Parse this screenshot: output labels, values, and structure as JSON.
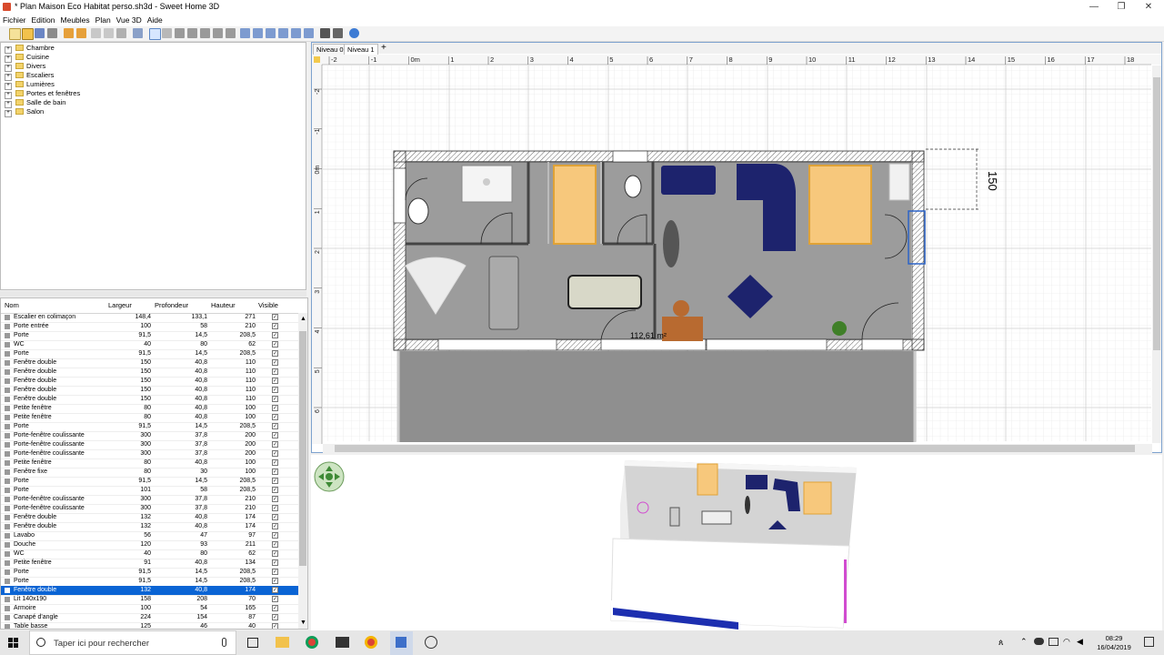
{
  "window": {
    "title": "* Plan Maison Eco Habitat perso.sh3d - Sweet Home 3D"
  },
  "menu": [
    "Fichier",
    "Edition",
    "Meubles",
    "Plan",
    "Vue 3D",
    "Aide"
  ],
  "catalog": {
    "categories": [
      "Chambre",
      "Cuisine",
      "Divers",
      "Escaliers",
      "Lumières",
      "Portes et fenêtres",
      "Salle de bain",
      "Salon"
    ]
  },
  "furniture": {
    "columns": [
      "Nom",
      "Largeur",
      "Profondeur",
      "Hauteur",
      "Visible"
    ],
    "rows": [
      [
        "Escalier en colimaçon",
        "148,4",
        "133,1",
        "271"
      ],
      [
        "Porte entrée",
        "100",
        "58",
        "210"
      ],
      [
        "Porte",
        "91,5",
        "14,5",
        "208,5"
      ],
      [
        "WC",
        "40",
        "80",
        "62"
      ],
      [
        "Porte",
        "91,5",
        "14,5",
        "208,5"
      ],
      [
        "Fenêtre double",
        "150",
        "40,8",
        "110"
      ],
      [
        "Fenêtre double",
        "150",
        "40,8",
        "110"
      ],
      [
        "Fenêtre double",
        "150",
        "40,8",
        "110"
      ],
      [
        "Fenêtre double",
        "150",
        "40,8",
        "110"
      ],
      [
        "Fenêtre double",
        "150",
        "40,8",
        "110"
      ],
      [
        "Petite fenêtre",
        "80",
        "40,8",
        "100"
      ],
      [
        "Petite fenêtre",
        "80",
        "40,8",
        "100"
      ],
      [
        "Porte",
        "91,5",
        "14,5",
        "208,5"
      ],
      [
        "Porte-fenêtre coulissante",
        "300",
        "37,8",
        "200"
      ],
      [
        "Porte-fenêtre coulissante",
        "300",
        "37,8",
        "200"
      ],
      [
        "Porte-fenêtre coulissante",
        "300",
        "37,8",
        "200"
      ],
      [
        "Petite fenêtre",
        "80",
        "40,8",
        "100"
      ],
      [
        "Fenêtre fixe",
        "80",
        "30",
        "100"
      ],
      [
        "Porte",
        "91,5",
        "14,5",
        "208,5"
      ],
      [
        "Porte",
        "101",
        "58",
        "208,5"
      ],
      [
        "Porte-fenêtre coulissante",
        "300",
        "37,8",
        "210"
      ],
      [
        "Porte-fenêtre coulissante",
        "300",
        "37,8",
        "210"
      ],
      [
        "Fenêtre double",
        "132",
        "40,8",
        "174"
      ],
      [
        "Fenêtre double",
        "132",
        "40,8",
        "174"
      ],
      [
        "Lavabo",
        "56",
        "47",
        "97"
      ],
      [
        "Douche",
        "120",
        "93",
        "211"
      ],
      [
        "WC",
        "40",
        "80",
        "62"
      ],
      [
        "Petite fenêtre",
        "91",
        "40,8",
        "134"
      ],
      [
        "Porte",
        "91,5",
        "14,5",
        "208,5"
      ],
      [
        "Porte",
        "91,5",
        "14,5",
        "208,5"
      ],
      [
        "Fenêtre double",
        "132",
        "40,8",
        "174"
      ],
      [
        "Lit 140x190",
        "158",
        "208",
        "70"
      ],
      [
        "Armoire",
        "100",
        "54",
        "165"
      ],
      [
        "Canapé d'angle",
        "224",
        "154",
        "87"
      ],
      [
        "Table basse",
        "125",
        "46",
        "40"
      ]
    ],
    "selected_index": 30
  },
  "plan": {
    "tabs": [
      "Niveau 0",
      "Niveau 1"
    ],
    "ruler_h": [
      "-2",
      "-1",
      "0m",
      "1",
      "2",
      "3",
      "4",
      "5",
      "6",
      "7",
      "8",
      "9",
      "10",
      "11",
      "12",
      "13",
      "14",
      "15",
      "16",
      "17",
      "18"
    ],
    "ruler_v": [
      "-2",
      "-1",
      "0m",
      "1",
      "2",
      "3",
      "4",
      "5",
      "6"
    ],
    "dimension_label": "150",
    "measure_label": "112,61 m²"
  },
  "taskbar": {
    "search_placeholder": "Taper ici pour rechercher",
    "time": "08:29",
    "date": "16/04/2019"
  },
  "colors": {
    "selection": "#0a64d4",
    "wall": "#444444",
    "floor": "#9a9a9a",
    "furniture_blue": "#1a1f6b",
    "bed_orange": "#f5c77a"
  }
}
